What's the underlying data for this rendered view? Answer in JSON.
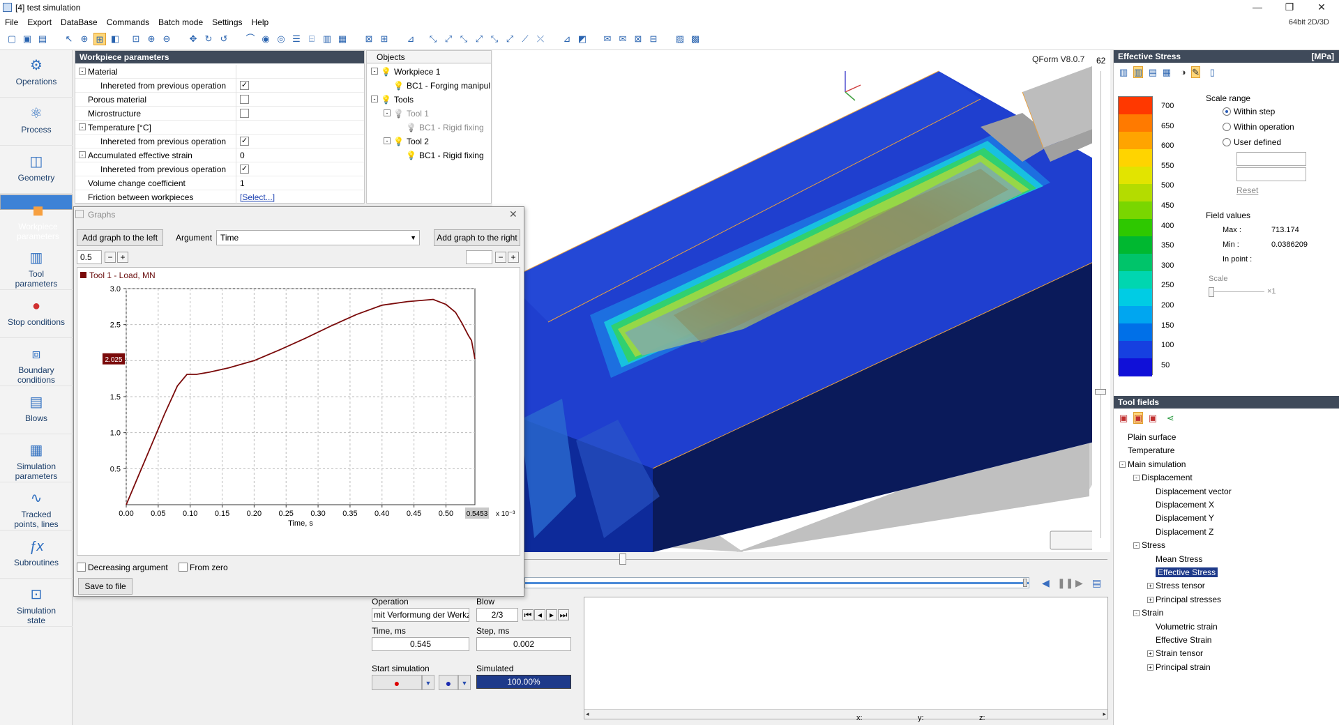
{
  "titlebar": {
    "title": "[4] test simulation",
    "controls": {
      "minimize": "—",
      "maximize": "❐",
      "close": "✕"
    }
  },
  "menu": {
    "items": [
      "File",
      "Export",
      "DataBase",
      "Commands",
      "Batch mode",
      "Settings",
      "Help"
    ],
    "mode": "64bit 2D/3D"
  },
  "nav": {
    "items": [
      {
        "id": "operations",
        "label": "Operations",
        "icon": "operations-icon"
      },
      {
        "id": "process",
        "label": "Process",
        "icon": "process-icon"
      },
      {
        "id": "geometry",
        "label": "Geometry",
        "icon": "geometry-icon"
      },
      {
        "id": "workpiece",
        "label": "Workpiece\nparameters",
        "icon": "workpiece-icon"
      },
      {
        "id": "tool",
        "label": "Tool\nparameters",
        "icon": "tool-icon"
      },
      {
        "id": "stop",
        "label": "Stop conditions",
        "icon": "traffic-light-icon"
      },
      {
        "id": "boundary",
        "label": "Boundary\nconditions",
        "icon": "boundary-icon"
      },
      {
        "id": "blows",
        "label": "Blows",
        "icon": "blows-icon"
      },
      {
        "id": "simparams",
        "label": "Simulation\nparameters",
        "icon": "sim-params-icon"
      },
      {
        "id": "tracked",
        "label": "Tracked\npoints, lines",
        "icon": "tracked-icon"
      },
      {
        "id": "subroutines",
        "label": "Subroutines",
        "icon": "fx-icon"
      },
      {
        "id": "simstate",
        "label": "Simulation\nstate",
        "icon": "sim-state-icon"
      }
    ]
  },
  "workpiece_panel": {
    "title": "Workpiece parameters",
    "rows": [
      {
        "label": "Material",
        "value": "",
        "expander": "-"
      },
      {
        "label": "Inhereted from previous operation",
        "value": "✓",
        "indent": true,
        "check": true
      },
      {
        "label": "Porous material",
        "value": "",
        "check": true
      },
      {
        "label": "Microstructure",
        "value": "",
        "check": true
      },
      {
        "label": "Temperature [°C]",
        "value": "",
        "expander": "-"
      },
      {
        "label": "Inhereted from previous operation",
        "value": "✓",
        "indent": true,
        "check": true
      },
      {
        "label": "Accumulated effective strain",
        "value": "0",
        "expander": "-"
      },
      {
        "label": "Inhereted from previous operation",
        "value": "✓",
        "indent": true,
        "check": true
      },
      {
        "label": "Volume change coefficient",
        "value": "1"
      },
      {
        "label": "Friction between workpieces",
        "value": "[Select...]",
        "link": true
      }
    ]
  },
  "objects": {
    "header": "Objects",
    "items": [
      {
        "label": "Workpiece 1",
        "level": 0,
        "expander": "-"
      },
      {
        "label": "BC1 - Forging manipul",
        "level": 1
      },
      {
        "label": "Tools",
        "level": 0,
        "expander": "-"
      },
      {
        "label": "Tool 1",
        "level": 1,
        "expander": "-",
        "dim": true
      },
      {
        "label": "BC1 - Rigid fixing",
        "level": 2,
        "dim": true
      },
      {
        "label": "Tool 2",
        "level": 1,
        "expander": "-"
      },
      {
        "label": "BC1 - Rigid fixing",
        "level": 2
      }
    ]
  },
  "viewport": {
    "version": "QForm V8.0.7",
    "counter": "62"
  },
  "graphs": {
    "title": "Graphs",
    "add_left": "Add graph to the left",
    "argument_label": "Argument",
    "argument_value": "Time",
    "add_right": "Add graph to the right",
    "left_spin": "0.5",
    "right_spin": "",
    "legend": "Tool 1 - Load, MN",
    "decreasing": "Decreasing argument",
    "from_zero": "From zero",
    "save": "Save to file"
  },
  "chart_data": {
    "type": "line",
    "title": "",
    "xlabel": "Time, s",
    "x_multiplier": "x 10⁻³",
    "ylabel": "",
    "xlim": [
      0,
      0.5453
    ],
    "ylim": [
      0,
      3.0
    ],
    "x_ticks": [
      "0.00",
      "0.05",
      "0.10",
      "0.15",
      "0.20",
      "0.25",
      "0.30",
      "0.35",
      "0.40",
      "0.45",
      "0.50"
    ],
    "y_ticks": [
      "0.5",
      "1.0",
      "1.5",
      "2.0",
      "2.5",
      "3.0"
    ],
    "cursor_x": "0.5453",
    "cursor_y": "2.025",
    "grid": true,
    "series": [
      {
        "name": "Tool 1 - Load, MN",
        "color": "#7a0a0a",
        "x": [
          0,
          0.02,
          0.04,
          0.06,
          0.08,
          0.095,
          0.11,
          0.13,
          0.16,
          0.2,
          0.24,
          0.28,
          0.32,
          0.36,
          0.4,
          0.44,
          0.48,
          0.5,
          0.515,
          0.525,
          0.535,
          0.54,
          0.5453
        ],
        "y": [
          0,
          0.42,
          0.84,
          1.26,
          1.65,
          1.81,
          1.81,
          1.84,
          1.9,
          2.0,
          2.15,
          2.31,
          2.48,
          2.64,
          2.77,
          2.82,
          2.85,
          2.78,
          2.67,
          2.52,
          2.35,
          2.28,
          2.025
        ]
      }
    ]
  },
  "bottom": {
    "operation_label": "Operation",
    "operation_value": "mit Verformung der Werkz",
    "blow_label": "Blow",
    "blow_value": "2/3",
    "time_label": "Time, ms",
    "time_value": "0.545",
    "step_label": "Step, ms",
    "step_value": "0.002",
    "start_label": "Start simulation",
    "simulated_label": "Simulated",
    "simulated_value": "100.00%",
    "status_x": "x:",
    "status_y": "y:",
    "status_z": "z:"
  },
  "effective_stress": {
    "title": "Effective Stress",
    "unit": "[MPa]",
    "ticks": [
      "700",
      "650",
      "600",
      "550",
      "500",
      "450",
      "400",
      "350",
      "300",
      "250",
      "200",
      "150",
      "100",
      "50"
    ],
    "colors": [
      "#ff3800",
      "#ff7a00",
      "#ffa400",
      "#ffd400",
      "#e2e400",
      "#b4dc00",
      "#7ad600",
      "#2ec800",
      "#00b830",
      "#00c46a",
      "#00d6b0",
      "#00cce4",
      "#00a6f0",
      "#0070e8",
      "#1640e0",
      "#1010d8"
    ],
    "scale_range_label": "Scale range",
    "within_step": "Within step",
    "within_operation": "Within operation",
    "user_defined": "User defined",
    "reset": "Reset",
    "field_values": "Field values",
    "max_label": "Max :",
    "max_value": "713.174",
    "min_label": "Min :",
    "min_value": "0.0386209",
    "inpoint_label": "In point :",
    "scale_label": "Scale",
    "scale_mult": "×1"
  },
  "tool_fields": {
    "title": "Tool fields",
    "items": [
      {
        "label": "Plain surface",
        "level": 0
      },
      {
        "label": "Temperature",
        "level": 0
      },
      {
        "label": "Main simulation",
        "level": 0,
        "expander": "-"
      },
      {
        "label": "Displacement",
        "level": 1,
        "expander": "-"
      },
      {
        "label": "Displacement vector",
        "level": 2
      },
      {
        "label": "Displacement X",
        "level": 2
      },
      {
        "label": "Displacement Y",
        "level": 2
      },
      {
        "label": "Displacement Z",
        "level": 2
      },
      {
        "label": "Stress",
        "level": 1,
        "expander": "-"
      },
      {
        "label": "Mean Stress",
        "level": 2
      },
      {
        "label": "Effective Stress",
        "level": 2,
        "selected": true
      },
      {
        "label": "Stress tensor",
        "level": 2,
        "expander": "+"
      },
      {
        "label": "Principal stresses",
        "level": 2,
        "expander": "+"
      },
      {
        "label": "Strain",
        "level": 1,
        "expander": "-"
      },
      {
        "label": "Volumetric strain",
        "level": 2
      },
      {
        "label": "Effective Strain",
        "level": 2
      },
      {
        "label": "Strain tensor",
        "level": 2,
        "expander": "+"
      },
      {
        "label": "Principal strain",
        "level": 2,
        "expander": "+"
      }
    ]
  }
}
